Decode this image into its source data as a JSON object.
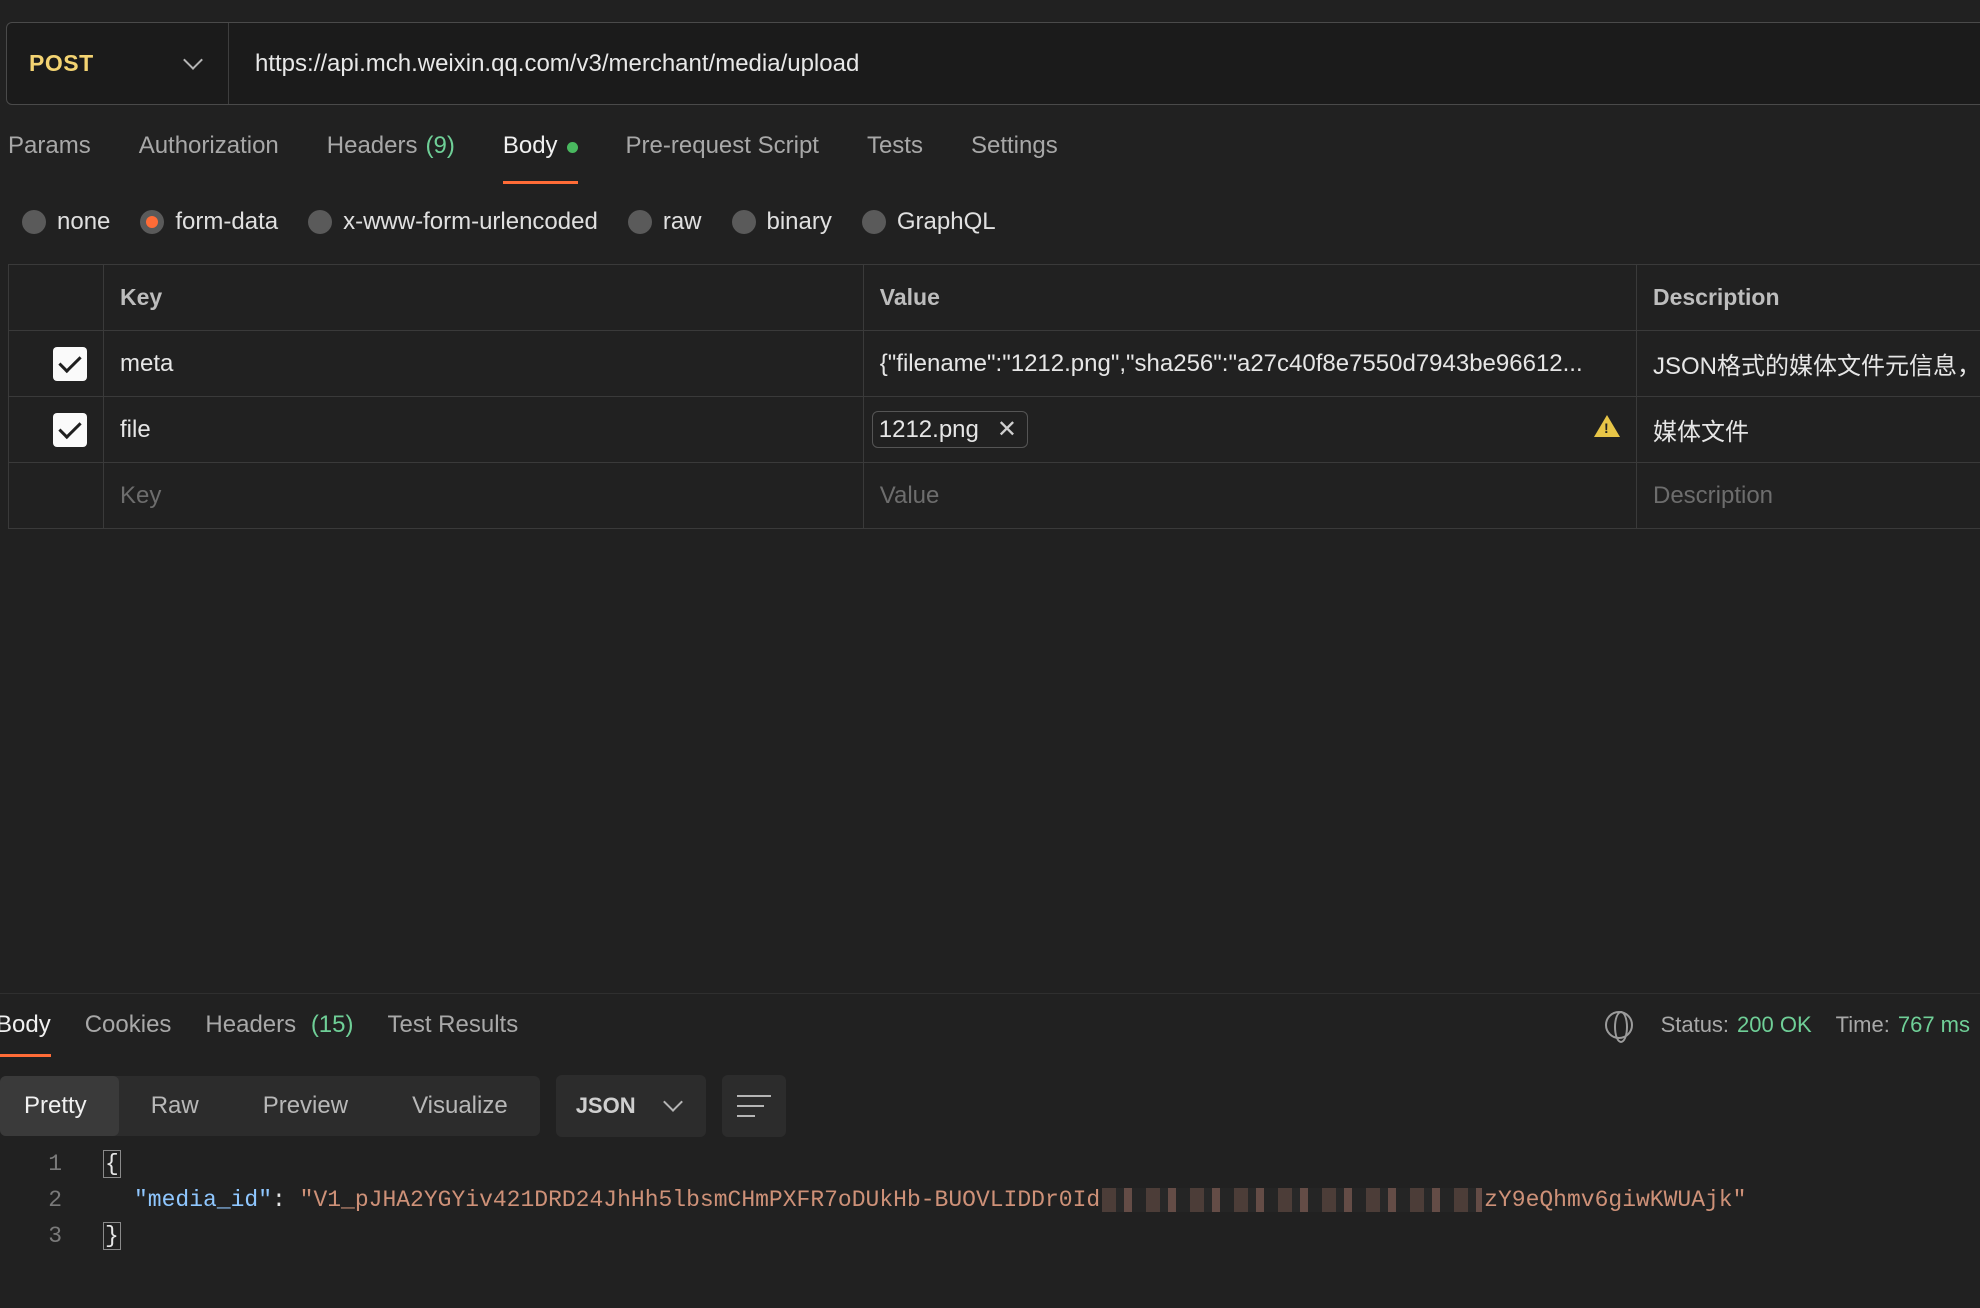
{
  "request": {
    "method": "POST",
    "url": "https://api.mch.weixin.qq.com/v3/merchant/media/upload"
  },
  "request_tabs": {
    "params": "Params",
    "authorization": "Authorization",
    "headers": "Headers",
    "headers_count": "(9)",
    "body": "Body",
    "pre_request": "Pre-request Script",
    "tests": "Tests",
    "settings": "Settings"
  },
  "body_types": {
    "none": "none",
    "form_data": "form-data",
    "urlencoded": "x-www-form-urlencoded",
    "raw": "raw",
    "binary": "binary",
    "graphql": "GraphQL",
    "selected": "form-data"
  },
  "table": {
    "headers": {
      "key": "Key",
      "value": "Value",
      "description": "Description"
    },
    "rows": [
      {
        "checked": true,
        "key": "meta",
        "value": "{\"filename\":\"1212.png\",\"sha256\":\"a27c40f8e7550d7943be96612...",
        "description": "JSON格式的媒体文件元信息，"
      },
      {
        "checked": true,
        "key": "file",
        "value": "1212.png",
        "description": "媒体文件"
      }
    ],
    "placeholder": {
      "key": "Key",
      "value": "Value",
      "description": "Description"
    }
  },
  "response": {
    "tabs": {
      "body": "Body",
      "cookies": "Cookies",
      "headers": "Headers",
      "headers_count": "(15)",
      "test_results": "Test Results"
    },
    "status_label": "Status:",
    "status_value": "200 OK",
    "time_label": "Time:",
    "time_value": "767 ms",
    "views": {
      "pretty": "Pretty",
      "raw": "Raw",
      "preview": "Preview",
      "visualize": "Visualize"
    },
    "format": "JSON",
    "code": {
      "line_numbers": [
        "1",
        "2",
        "3"
      ],
      "open": "{",
      "key": "\"media_id\"",
      "colon": ": ",
      "value_start": "\"V1_pJHA2YGYiv421DRD24JhHh5lbsmCHmPXFR7oDUkHb-BUOVLIDDr0Id",
      "value_end": "zY9eQhmv6giwKWUAjk\"",
      "close": "}"
    }
  },
  "colors": {
    "accent": "#ff6c37",
    "method": "#f3d372",
    "success": "#6fcf97",
    "json_key": "#8fc7ff",
    "json_string": "#ce9178"
  }
}
